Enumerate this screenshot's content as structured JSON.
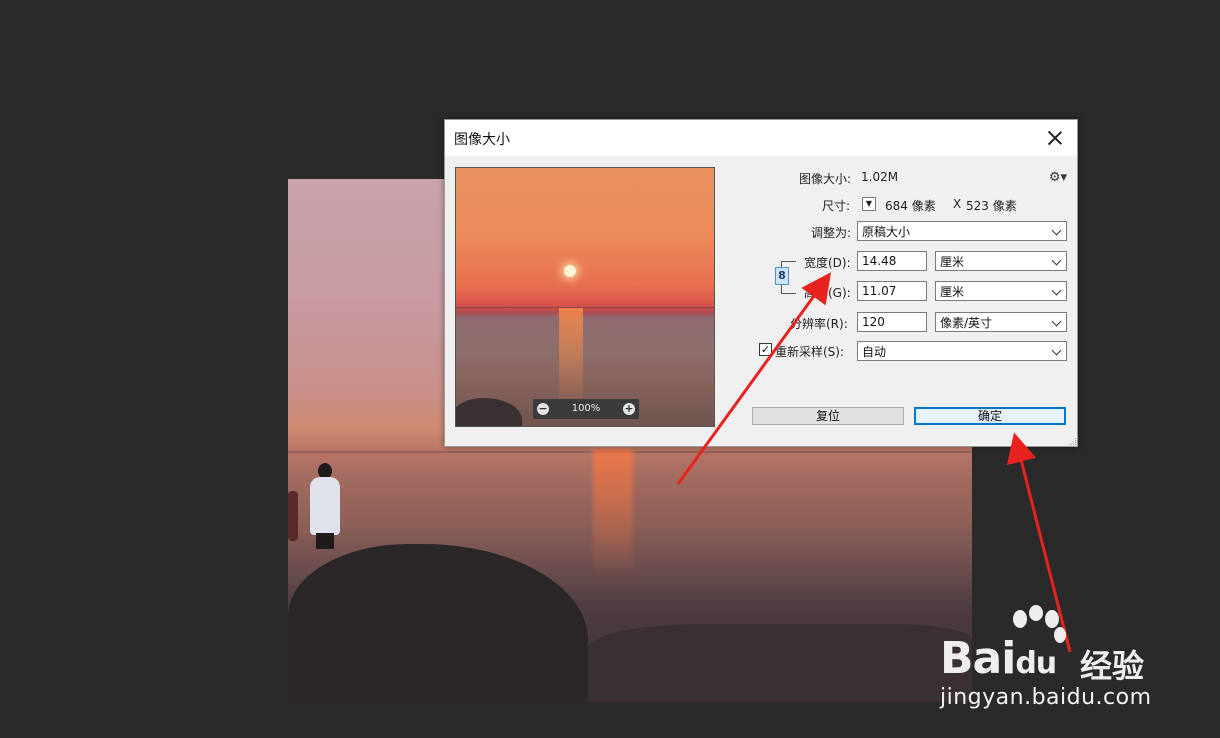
{
  "dialog": {
    "title": "图像大小",
    "image_size_label": "图像大小:",
    "image_size_value": "1.02M",
    "dimensions_label": "尺寸:",
    "dimensions_width": "684 像素",
    "dimensions_sep": "X",
    "dimensions_height": "523 像素",
    "fit_to_label": "调整为:",
    "fit_to_value": "原稿大小",
    "width_label": "宽度(D):",
    "width_value": "14.48",
    "width_unit": "厘米",
    "height_label": "高度(G):",
    "height_value": "11.07",
    "height_unit": "厘米",
    "resolution_label": "分辨率(R):",
    "resolution_value": "120",
    "resolution_unit": "像素/英寸",
    "resample_label": "重新采样(S):",
    "resample_checked": true,
    "resample_value": "自动",
    "preview_zoom": "100%",
    "reset_label": "复位",
    "ok_label": "确定"
  },
  "icons": {
    "close": "close-icon",
    "gear": "gear-icon",
    "link": "chain-link-icon",
    "zoom_out": "minus-circle-icon",
    "zoom_in": "plus-circle-icon"
  },
  "watermark": {
    "logo": "Bai",
    "logo_suffix": "du",
    "brand_cn": "经验",
    "url": "jingyan.baidu.com"
  },
  "colors": {
    "workspace_bg": "#2a2a2a",
    "dialog_bg": "#f0f0f0",
    "ok_border": "#0078d7",
    "arrow": "#e8221e"
  }
}
